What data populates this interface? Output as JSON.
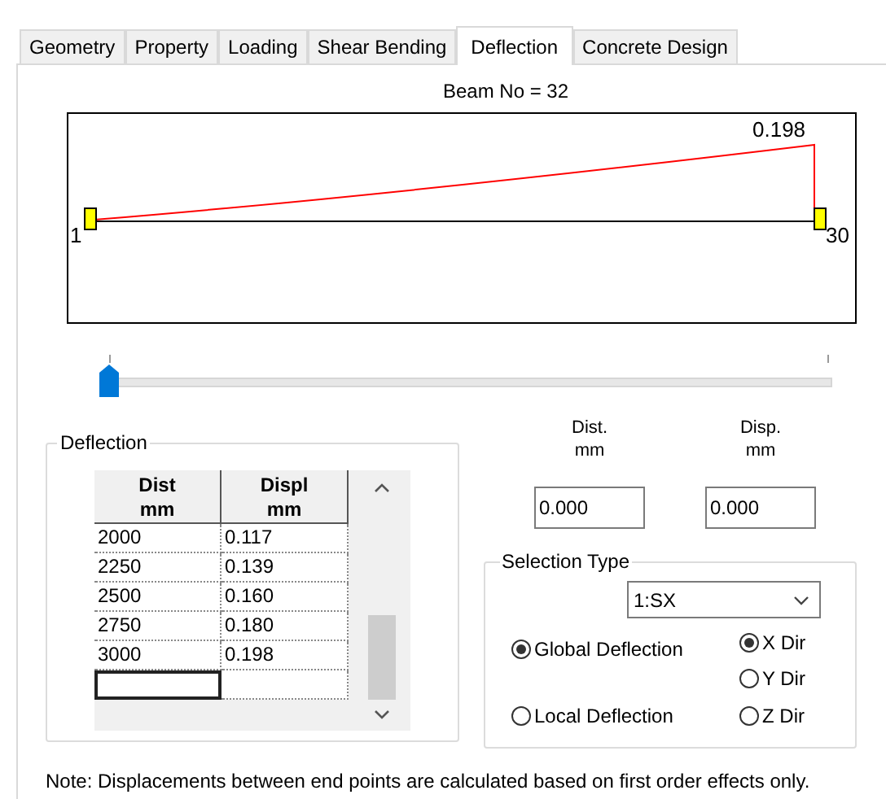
{
  "tabs": [
    {
      "label": "Geometry",
      "selected": false
    },
    {
      "label": "Property",
      "selected": false
    },
    {
      "label": "Loading",
      "selected": false
    },
    {
      "label": "Shear Bending",
      "selected": false
    },
    {
      "label": "Deflection",
      "selected": true
    },
    {
      "label": "Concrete Design",
      "selected": false
    }
  ],
  "beam_title": "Beam No = 32",
  "diagram": {
    "max_label": "0.198",
    "start_node": "1",
    "end_node": "30"
  },
  "slider": {
    "level": 0
  },
  "deflection_table": {
    "title": "Deflection",
    "columns": [
      {
        "name": "Dist",
        "unit": "mm"
      },
      {
        "name": "Displ",
        "unit": "mm"
      }
    ],
    "rows": [
      [
        "2000",
        "0.117"
      ],
      [
        "2250",
        "0.139"
      ],
      [
        "2500",
        "0.160"
      ],
      [
        "2750",
        "0.180"
      ],
      [
        "3000",
        "0.198"
      ]
    ],
    "new_row": {
      "focused": true
    }
  },
  "fields": [
    {
      "label": "Dist.",
      "unit": "mm",
      "value": "0.000"
    },
    {
      "label": "Disp.",
      "unit": "mm",
      "value": "0.000"
    }
  ],
  "selection_type": {
    "title": "Selection Type",
    "dropdown": "1:SX",
    "modes": [
      {
        "label": "Global Deflection",
        "selected": true
      },
      {
        "label": "Local Deflection",
        "selected": false
      }
    ],
    "directions": [
      {
        "label": "X Dir",
        "selected": true
      },
      {
        "label": "Y Dir",
        "selected": false
      },
      {
        "label": "Z Dir",
        "selected": false
      }
    ]
  },
  "note": "Note: Displacements between end points are calculated based on first order effects only."
}
